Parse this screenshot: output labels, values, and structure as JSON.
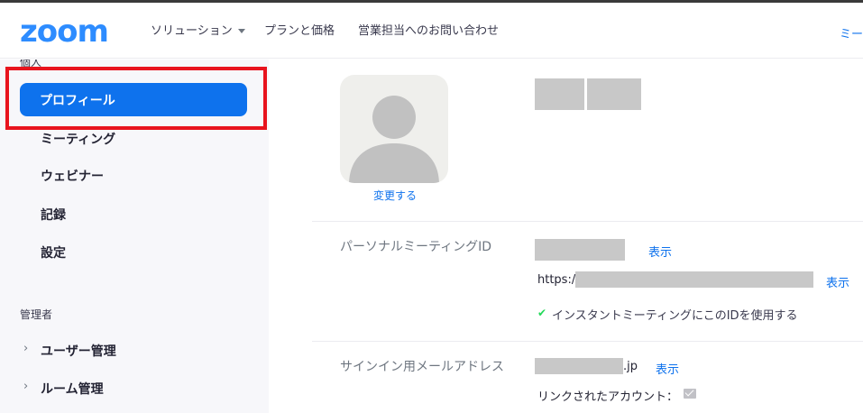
{
  "header": {
    "logo": "zoom",
    "nav": [
      "ソリューション",
      "プランと価格",
      "営業担当へのお問い合わせ"
    ],
    "right_link": "ミー"
  },
  "sidebar": {
    "personal_label": "個人",
    "items": [
      "プロフィール",
      "ミーティング",
      "ウェビナー",
      "記録",
      "設定"
    ],
    "admin_label": "管理者",
    "admin_items": [
      "ユーザー管理",
      "ルーム管理"
    ]
  },
  "profile": {
    "change_link": "変更する",
    "pmi_label": "パーソナルミーティングID",
    "show": "表示",
    "url_prefix": "https://",
    "use_pmi_text": "インスタントミーティングにこのIDを使用する",
    "email_label": "サインイン用メールアドレス",
    "email_suffix": ".jp",
    "linked_accounts": "リンクされたアカウント："
  },
  "colors": {
    "accent": "#0e72ed",
    "logo": "#2d8cff",
    "highlight": "#e8131d",
    "check": "#23d959"
  }
}
